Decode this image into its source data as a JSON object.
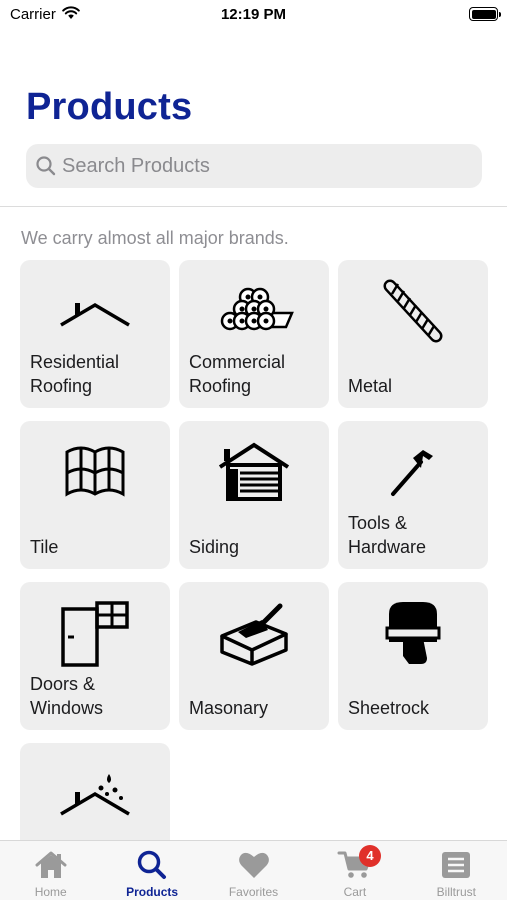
{
  "status_bar": {
    "carrier": "Carrier",
    "time": "12:19 PM"
  },
  "header": {
    "title": "Products"
  },
  "search": {
    "placeholder": "Search Products",
    "value": ""
  },
  "brands_note": "We carry almost all major brands.",
  "categories": [
    {
      "label": "Residential\nRoofing",
      "icon": "roof-icon"
    },
    {
      "label": "Commercial\nRoofing",
      "icon": "rolls-icon"
    },
    {
      "label": "Metal",
      "icon": "rebar-icon"
    },
    {
      "label": "Tile",
      "icon": "tile-icon"
    },
    {
      "label": "Siding",
      "icon": "house-siding-icon"
    },
    {
      "label": "Tools &\nHardware",
      "icon": "hammer-icon"
    },
    {
      "label": "Doors &\nWindows",
      "icon": "door-window-icon"
    },
    {
      "label": "Masonary",
      "icon": "brick-trowel-icon"
    },
    {
      "label": "Sheetrock",
      "icon": "drywall-icon"
    },
    {
      "label": "",
      "icon": "roof-leak-icon"
    }
  ],
  "tabs": [
    {
      "label": "Home",
      "icon": "home-icon",
      "active": false
    },
    {
      "label": "Products",
      "icon": "search-icon",
      "active": true
    },
    {
      "label": "Favorites",
      "icon": "heart-icon",
      "active": false
    },
    {
      "label": "Cart",
      "icon": "cart-icon",
      "active": false,
      "badge": "4"
    },
    {
      "label": "Billtrust",
      "icon": "document-icon",
      "active": false
    }
  ],
  "colors": {
    "accent": "#0f2494",
    "badge": "#e0302a",
    "tile_bg": "#eeeeee",
    "inactive_tab": "#9a9a9a"
  }
}
